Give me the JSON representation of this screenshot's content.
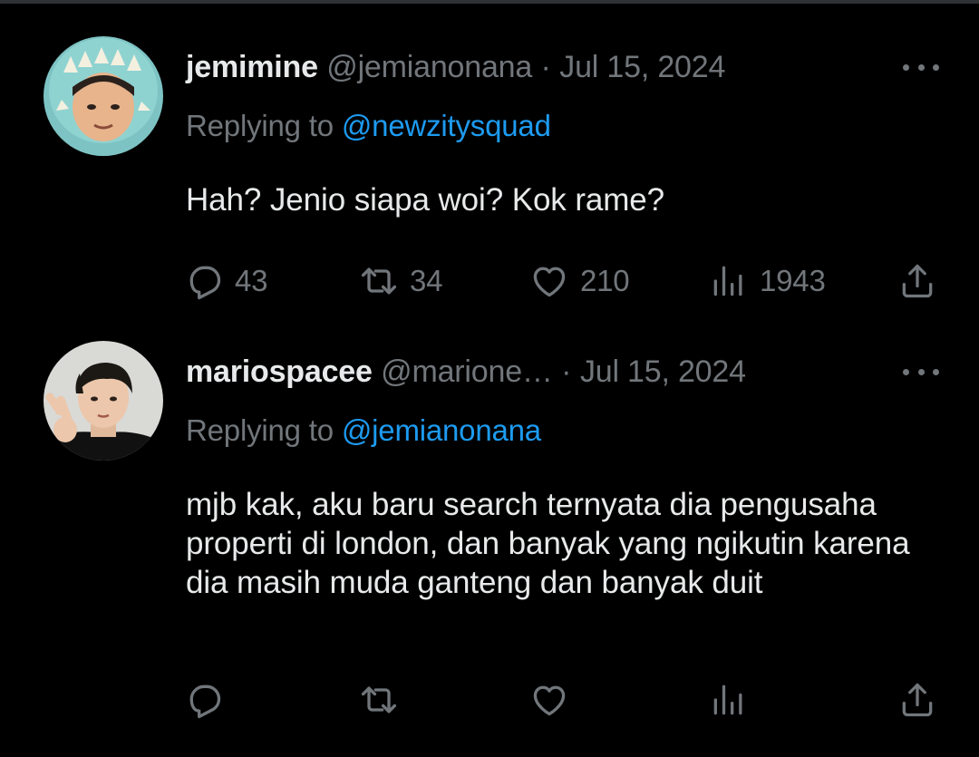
{
  "tweets": [
    {
      "display_name": "jemimine",
      "handle": "@jemianonana",
      "separator": " · ",
      "date": "Jul 15, 2024",
      "replying_prefix": "Replying to",
      "replying_to": "@newzitysquad",
      "text": "Hah? Jenio siapa woi? Kok rame?",
      "reply_count": "43",
      "retweet_count": "34",
      "like_count": "210",
      "view_count": "1943"
    },
    {
      "display_name": "mariospacee",
      "handle": "@marione…",
      "separator": " · ",
      "date": "Jul 15, 2024",
      "replying_prefix": "Replying to",
      "replying_to": "@jemianonana",
      "text": "mjb kak, aku baru search ternyata dia pengusaha properti di london, dan banyak yang ngikutin karena dia masih muda ganteng dan banyak duit",
      "reply_count": "",
      "retweet_count": "",
      "like_count": "",
      "view_count": ""
    }
  ],
  "icons": {
    "reply": "reply-icon",
    "retweet": "retweet-icon",
    "like": "heart-icon",
    "views": "views-icon",
    "share": "share-icon",
    "more": "more-icon"
  },
  "colors": {
    "background": "#000000",
    "primary_text": "#e7e9ea",
    "secondary_text": "#71767b",
    "link": "#1d9bf0"
  }
}
